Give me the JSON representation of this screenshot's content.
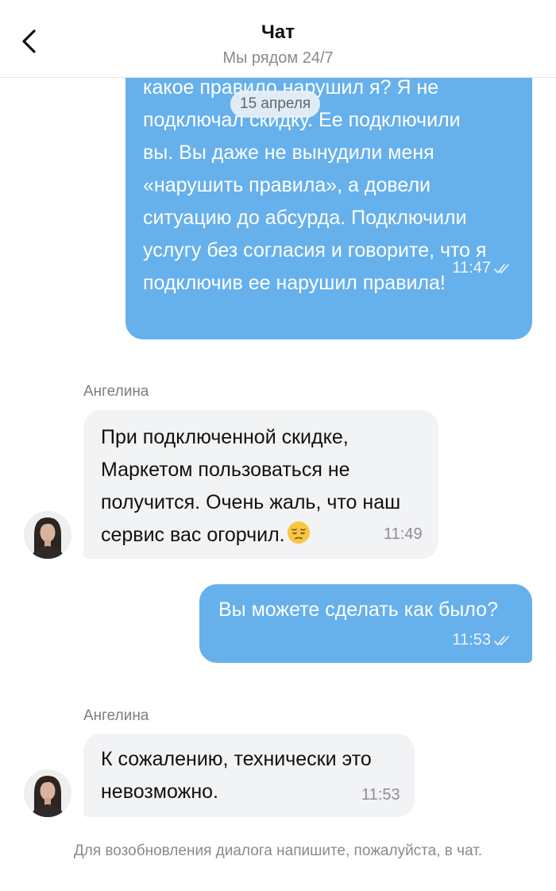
{
  "header": {
    "title": "Чат",
    "subtitle": "Мы рядом 24/7",
    "back_icon": "chevron-left-icon"
  },
  "date_divider": "15 апреля",
  "messages": [
    {
      "direction": "outgoing",
      "text": "какое правило нарушил я? Я не\nподключал скидку. Ее подключили\nвы. Вы даже не вынудили меня\n«нарушить правила», а довели\nситуацию до абсурда. Подключили\nуслугу без согласия и говорите, что я\nподключив ее нарушил правила!",
      "time": "11:47",
      "status_icon": "double-check-icon"
    },
    {
      "direction": "incoming",
      "sender": "Ангелина",
      "text": "При подключенной скидке,\nМаркетом пользоваться не\nполучится. Очень жаль, что наш\nсервис вас огорчил.",
      "emoji": "pensive-face-icon",
      "time": "11:49"
    },
    {
      "direction": "outgoing",
      "text": "Вы можете сделать как было?",
      "time": "11:53",
      "status_icon": "double-check-icon"
    },
    {
      "direction": "incoming",
      "sender": "Ангелина",
      "text": "К сожалению, технически это\nневозможно.",
      "time": "11:53"
    }
  ],
  "footer_note": "Для возобновления диалога напишите, пожалуйста, в чат.",
  "colors": {
    "outgoing_bubble": "#66b0ec",
    "incoming_bubble": "#f2f3f5",
    "secondary_text": "#8a8a8e"
  }
}
